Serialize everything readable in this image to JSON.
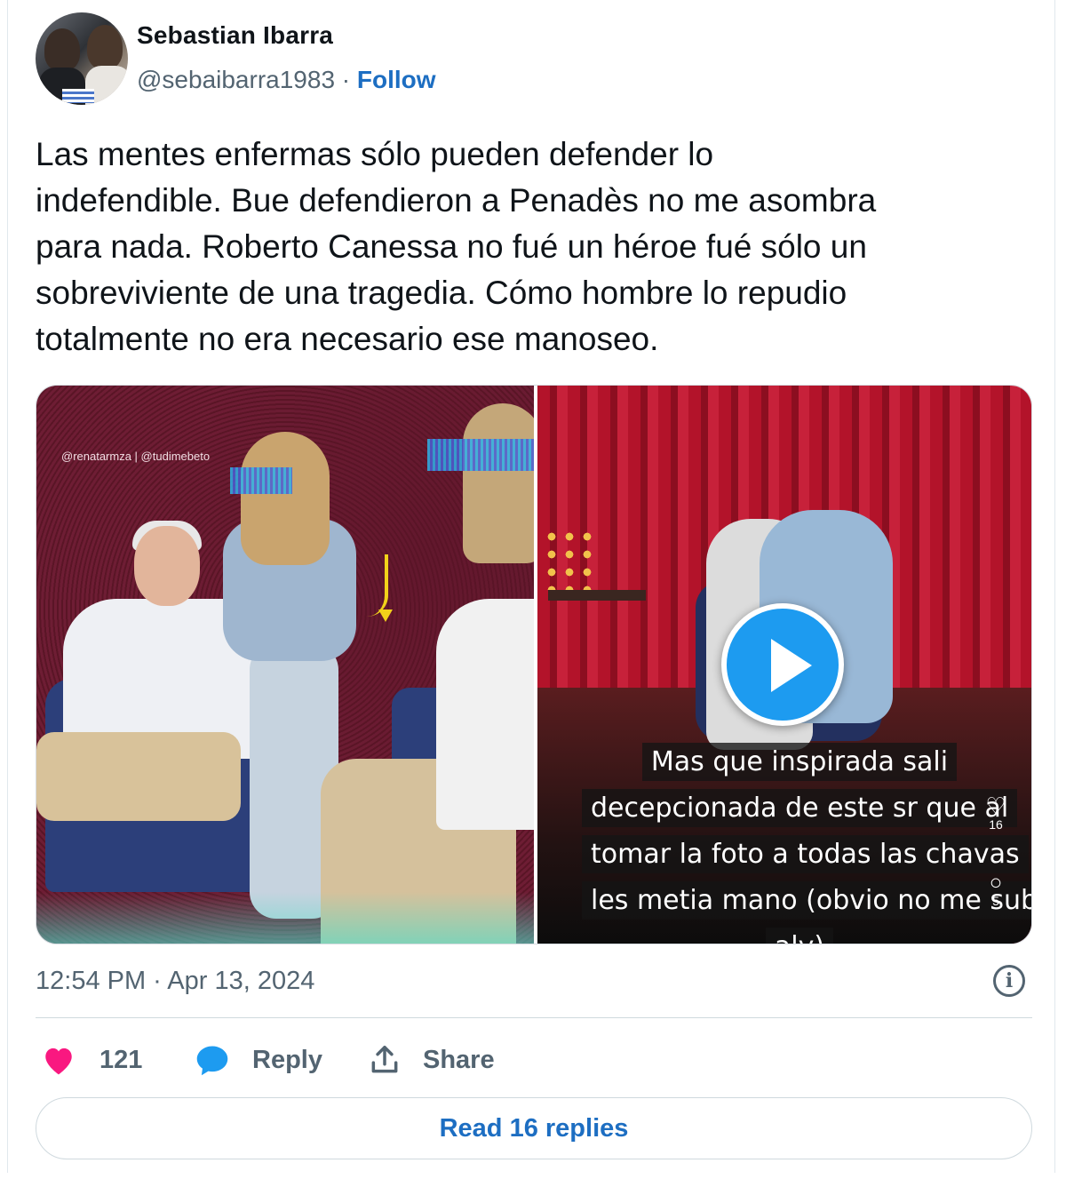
{
  "author": {
    "name": "Sebastian Ibarra",
    "handle": "@sebaibarra1983",
    "separator": "·",
    "follow_label": "Follow"
  },
  "tweet": {
    "lines": [
      "Las mentes enfermas sólo pueden defender lo",
      "indefendible. Bue defendieron a Penadès no me asombra",
      "para nada. Roberto Canessa no fué un héroe fué sólo un",
      "sobreviviente de una tragedia. Cómo hombre lo  repudio",
      "totalmente no era necesario ese manoseo."
    ]
  },
  "media": {
    "left_image": {
      "watermark": "@renatarmza | @tudimebeto"
    },
    "right_video": {
      "caption_lines": [
        "Mas que inspirada sali",
        "decepcionada de este sr que al",
        "tomar la foto a todas las chavas",
        "les metia mano (obvio no me subi",
        "aly)"
      ],
      "like_count": "16",
      "comment_count": "5"
    }
  },
  "meta": {
    "timestamp": "12:54 PM · Apr 13, 2024"
  },
  "actions": {
    "like_count": "121",
    "reply_label": "Reply",
    "share_label": "Share",
    "read_replies_label": "Read 16 replies"
  },
  "colors": {
    "link_blue": "#1d6ec2",
    "heart_pink": "#f91880",
    "reply_blue": "#1d9bf0",
    "muted_text": "#536471"
  }
}
